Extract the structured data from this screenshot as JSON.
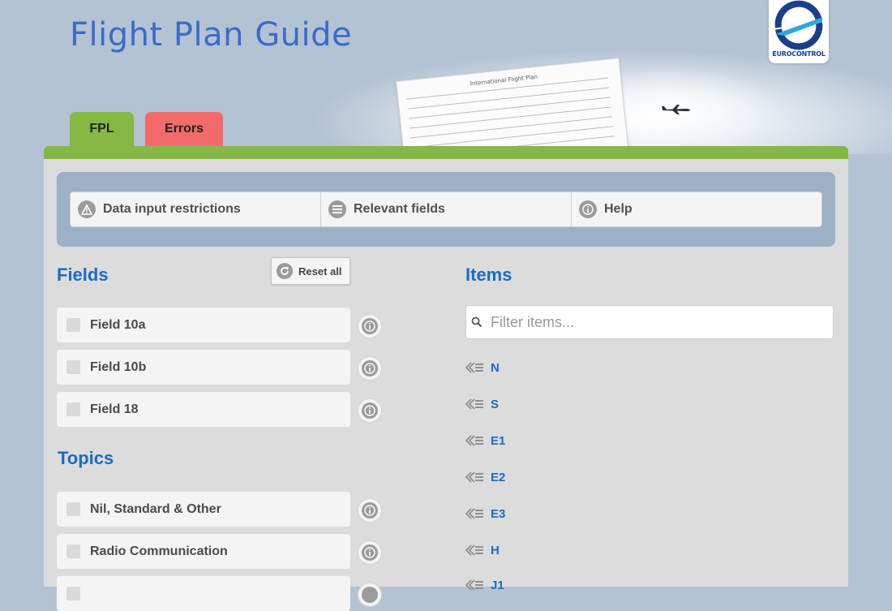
{
  "header": {
    "title": "Flight Plan Guide",
    "logo_text": "EUROCONTROL",
    "form_title": "International Flight Plan"
  },
  "tabs": [
    {
      "label": "FPL",
      "color": "#86b845"
    },
    {
      "label": "Errors",
      "color": "#f26b6b"
    }
  ],
  "toolbar": {
    "items": [
      {
        "label": "Data input restrictions",
        "icon": "warning-icon"
      },
      {
        "label": "Relevant fields",
        "icon": "list-icon"
      },
      {
        "label": "Help",
        "icon": "info-icon"
      }
    ]
  },
  "fields": {
    "heading": "Fields",
    "reset_label": "Reset all",
    "items": [
      {
        "label": "Field 10a"
      },
      {
        "label": "Field 10b"
      },
      {
        "label": "Field 18"
      }
    ]
  },
  "topics": {
    "heading": "Topics",
    "items": [
      {
        "label": "Nil, Standard & Other"
      },
      {
        "label": "Radio Communication"
      }
    ]
  },
  "items_panel": {
    "heading": "Items",
    "filter_placeholder": "Filter items...",
    "items": [
      "N",
      "S",
      "E1",
      "E2",
      "E3",
      "H",
      "J1"
    ]
  },
  "colors": {
    "accent": "#86b845",
    "error": "#f26b6b",
    "heading": "#1a6cc4",
    "title": "#3a6cc8"
  }
}
